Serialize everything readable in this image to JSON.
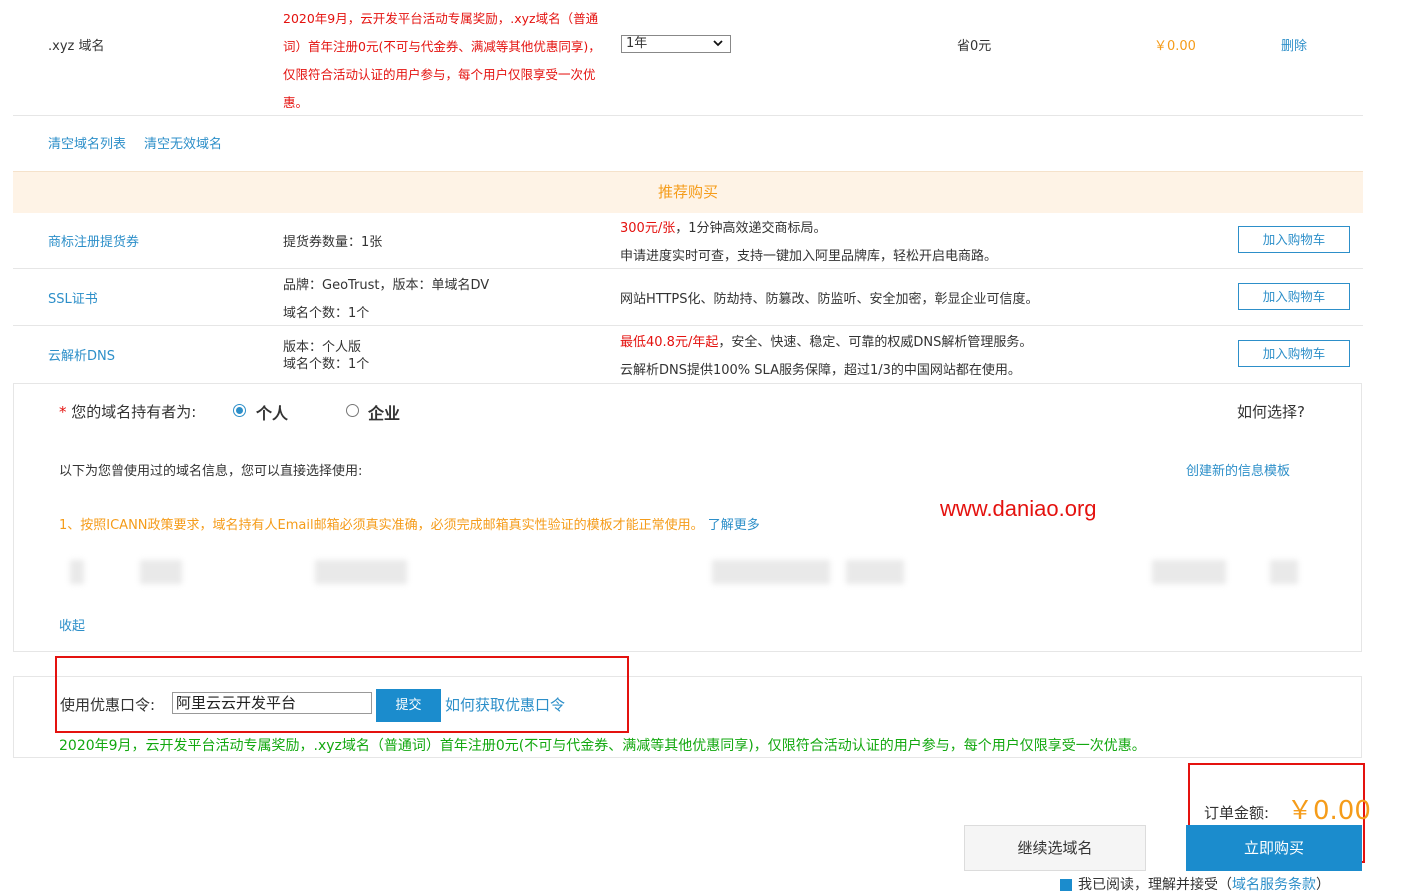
{
  "domain_row": {
    "name": ".xyz 域名",
    "promo": "2020年9月，云开发平台活动专属奖励，.xyz域名（普通词）首年注册0元(不可与代金券、满减等其他优惠同享)，仅限符合活动认证的用户参与，每个用户仅限享受一次优惠。",
    "period": "1年",
    "save": "省0元",
    "price": "￥0.00",
    "delete_label": "删除"
  },
  "list_actions": {
    "clear_list": "清空域名列表",
    "clear_invalid": "清空无效域名"
  },
  "recommend": {
    "title": "推荐购买",
    "add_to_cart": "加入购物车",
    "items": [
      {
        "name": "商标注册提货券",
        "spec1": "提货券数量：1张",
        "spec2": "",
        "desc_highlight": "300元/张",
        "desc1_rest": "，1分钟高效递交商标局。",
        "desc2": "申请进度实时可查，支持一键加入阿里品牌库，轻松开启电商路。"
      },
      {
        "name": "SSL证书",
        "spec1": "品牌：GeoTrust，版本：单域名DV",
        "spec2": "域名个数：1个",
        "desc_highlight": "",
        "desc1_rest": "网站HTTPS化、防劫持、防篡改、防监听、安全加密，彰显企业可信度。",
        "desc2": ""
      },
      {
        "name": "云解析DNS",
        "spec1": "版本：个人版",
        "spec2": "域名个数：1个",
        "desc_highlight": "最低40.8元/年起",
        "desc1_rest": "，安全、快速、稳定、可靠的权威DNS解析管理服务。",
        "desc2": "云解析DNS提供100% SLA服务保障，超过1/3的中国网站都在使用。"
      }
    ]
  },
  "holder": {
    "required_mark": "*",
    "label": "您的域名持有者为:",
    "option_personal": "个人",
    "option_company": "企业",
    "selected": "个人",
    "how_to_choose": "如何选择?",
    "template_hint": "以下为您曾使用过的域名信息，您可以直接选择使用:",
    "create_template": "创建新的信息模板",
    "icann_notice": "1、按照ICANN政策要求，域名持有人Email邮箱必须真实准确，必须完成邮箱真实性验证的模板才能正常使用。",
    "learn_more": "了解更多",
    "collapse": "收起"
  },
  "watermark": "www.daniao.org",
  "coupon": {
    "label": "使用优惠口令:",
    "value": "阿里云云开发平台",
    "submit": "提交",
    "how_to_get": "如何获取优惠口令",
    "applied_message": "2020年9月，云开发平台活动专属奖励，.xyz域名（普通词）首年注册0元(不可与代金券、满减等其他优惠同享)，仅限符合活动认证的用户参与，每个用户仅限享受一次优惠。"
  },
  "order": {
    "total_label": "订单金额:",
    "total_value": "￥0.00",
    "continue_label": "继续选域名",
    "buy_label": "立即购买",
    "agreement_prefix": "我已阅读，理解并接受",
    "agreement_link": "域名服务条款"
  },
  "colors": {
    "accent": "#2d8fc9",
    "red": "#e4120f",
    "orange": "#f59c1a",
    "green": "#13a810"
  }
}
